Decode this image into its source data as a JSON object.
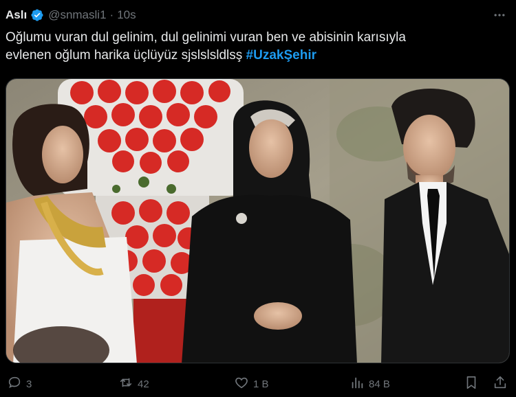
{
  "tweet": {
    "display_name": "Aslı",
    "handle": "@snmasli1",
    "separator": "·",
    "time": "10s",
    "text_line1": "Oğlumu vuran dul gelinim, dul gelinimi vuran ben ve abisinin karısıyla",
    "text_line2": "evlenen oğlum harika üçlüyüz sjslslsldlsş ",
    "hashtag": "#UzakŞehir"
  },
  "actions": {
    "reply_count": "3",
    "repost_count": "42",
    "like_count": "1 B",
    "views_count": "84 B"
  },
  "icons": {
    "verified": "verified-badge-icon",
    "more": "more-icon",
    "reply": "reply-icon",
    "repost": "repost-icon",
    "like": "like-icon",
    "views": "views-icon",
    "bookmark": "bookmark-icon",
    "share": "share-icon"
  },
  "colors": {
    "background": "#000000",
    "text": "#e7e9ea",
    "muted": "#71767b",
    "accent": "#1d9bf0"
  }
}
